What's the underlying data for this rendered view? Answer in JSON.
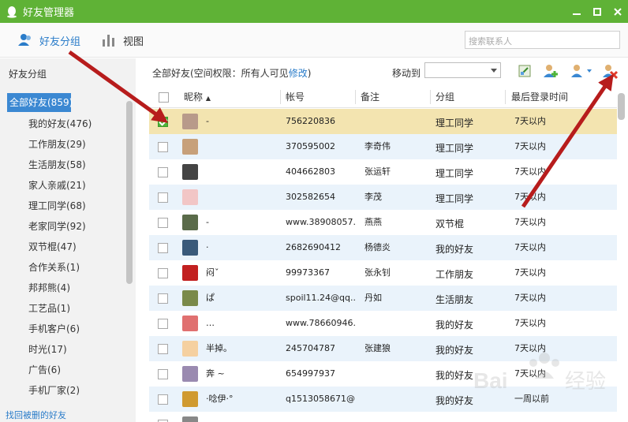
{
  "window": {
    "title": "好友管理器",
    "logo_icon": "qq-penguin-icon",
    "controls": [
      "minimize-icon",
      "maximize-icon",
      "close-icon"
    ],
    "accent": "#5fb236"
  },
  "toolbar": {
    "friends_group_label": "好友分组",
    "view_label": "视图",
    "search_placeholder": "搜索联系人"
  },
  "sidebar": {
    "title": "好友分组",
    "groups": [
      {
        "label": "全部好友(859)",
        "active": true
      },
      {
        "label": "我的好友(476)"
      },
      {
        "label": "工作朋友(29)"
      },
      {
        "label": "生活朋友(58)"
      },
      {
        "label": "家人亲戚(21)"
      },
      {
        "label": "理工同学(68)"
      },
      {
        "label": "老家同学(92)"
      },
      {
        "label": "双节棍(47)"
      },
      {
        "label": "合作关系(1)"
      },
      {
        "label": "邦邦熊(4)"
      },
      {
        "label": "工艺品(1)"
      },
      {
        "label": "手机客户(6)"
      },
      {
        "label": "时光(17)"
      },
      {
        "label": "广告(6)"
      },
      {
        "label": "手机厂家(2)"
      }
    ],
    "footer_link": "找回被删的好友"
  },
  "main": {
    "permission_text": "全部好友(空间权限：所有人可见",
    "permission_link": "修改",
    "permission_close": ")",
    "move_to_label": "移动到",
    "move_to_value": "",
    "action_icons": [
      "edit-remark-icon",
      "add-friend-icon",
      "contact-menu-icon",
      "delete-friend-icon"
    ],
    "columns": {
      "nickname": "昵称",
      "account": "帐号",
      "remark": "备注",
      "group": "分组",
      "last_login": "最后登录时间"
    },
    "rows": [
      {
        "checked": true,
        "nick": "-",
        "account": "756220836",
        "remark": "",
        "group": "理工同学",
        "login": "7天以内",
        "style": "sel",
        "avatar": "#b89a8a"
      },
      {
        "checked": false,
        "nick": "",
        "account": "370595002",
        "remark": "李奇伟",
        "group": "理工同学",
        "login": "7天以内",
        "style": "alt",
        "avatar": "#c7a07a"
      },
      {
        "checked": false,
        "nick": "",
        "account": "404662803",
        "remark": "张运轩",
        "group": "理工同学",
        "login": "7天以内",
        "style": "",
        "avatar": "#444444"
      },
      {
        "checked": false,
        "nick": "",
        "account": "302582654",
        "remark": "李茂",
        "group": "理工同学",
        "login": "7天以内",
        "style": "alt",
        "avatar": "#f2c6c6"
      },
      {
        "checked": false,
        "nick": "-",
        "account": "www.38908057...",
        "remark": "燕燕",
        "group": "双节棍",
        "login": "7天以内",
        "style": "",
        "avatar": "#5a6b4a"
      },
      {
        "checked": false,
        "nick": "·",
        "account": "2682690412",
        "remark": "杨德炎",
        "group": "我的好友",
        "login": "7天以内",
        "style": "alt",
        "avatar": "#3a5a7a"
      },
      {
        "checked": false,
        "nick": "闷ˇ",
        "account": "99973367",
        "remark": "张永钊",
        "group": "工作朋友",
        "login": "7天以内",
        "style": "",
        "avatar": "#c22020"
      },
      {
        "checked": false,
        "nick": "ぱ",
        "account": "spoil11.24@qq....",
        "remark": "丹如",
        "group": "生活朋友",
        "login": "7天以内",
        "style": "alt",
        "avatar": "#7a8a4a"
      },
      {
        "checked": false,
        "nick": "…",
        "account": "www.78660946...",
        "remark": "",
        "group": "我的好友",
        "login": "7天以内",
        "style": "",
        "avatar": "#e07070"
      },
      {
        "checked": false,
        "nick": "半掉。",
        "account": "245704787",
        "remark": "张建狼",
        "group": "我的好友",
        "login": "7天以内",
        "style": "alt",
        "avatar": "#f5d0a0"
      },
      {
        "checked": false,
        "nick": "奔 ~",
        "account": "654997937",
        "remark": "",
        "group": "我的好友",
        "login": "7天以内",
        "style": "",
        "avatar": "#9a8ab0"
      },
      {
        "checked": false,
        "nick": "·唸伊·°",
        "account": "q1513058671@...",
        "remark": "",
        "group": "我的好友",
        "login": "一周以前",
        "style": "alt",
        "avatar": "#d09a30"
      },
      {
        "checked": false,
        "nick": "",
        "account": "",
        "remark": "",
        "group": "",
        "login": "",
        "style": "",
        "avatar": "#888888"
      }
    ]
  },
  "watermark": "Bai 经验"
}
